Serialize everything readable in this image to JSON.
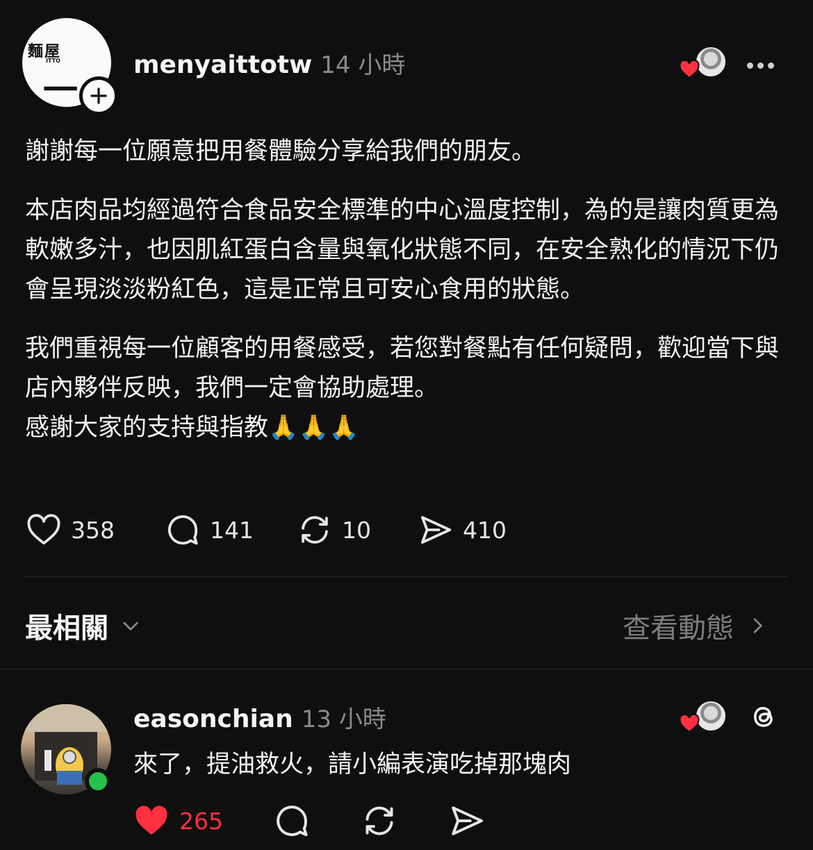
{
  "post": {
    "avatar_logo": {
      "small_text": "麵屋",
      "itto_text": "ITTO",
      "big_text": "一燈"
    },
    "username": "menyaittotw",
    "time_ago": "14 小時",
    "paragraphs": [
      "謝謝每一位願意把用餐體驗分享給我們的朋友。",
      "本店肉品均經過符合食品安全標準的中心溫度控制，為的是讓肉質更為軟嫩多汁，也因肌紅蛋白含量與氧化狀態不同，在安全熟化的情況下仍會呈現淡淡粉紅色，這是正常且可安心食用的狀態。",
      "我們重視每一位顧客的用餐感受，若您對餐點有任何疑問，歡迎當下與店內夥伴反映，我們一定會協助處理。",
      "感謝大家的支持與指教🙏🙏🙏"
    ],
    "actions": {
      "likes": "358",
      "comments": "141",
      "reposts": "10",
      "shares": "410"
    }
  },
  "replies_header": {
    "sort_label": "最相關",
    "activity_link": "查看動態"
  },
  "reply": {
    "username": "easonchian",
    "time_ago": "13 小時",
    "text": "來了，提油救火，請小編表演吃掉那塊肉",
    "likes": "265"
  },
  "colors": {
    "background": "#0f0f0f",
    "heart_red": "#ff3040",
    "online_green": "#24c24a",
    "muted_text": "#8a8a8a"
  },
  "icons": [
    "plus-icon",
    "heart-icon",
    "comment-icon",
    "repost-icon",
    "share-icon",
    "more-icon",
    "chevron-down-icon",
    "chevron-right-icon",
    "threads-icon"
  ]
}
